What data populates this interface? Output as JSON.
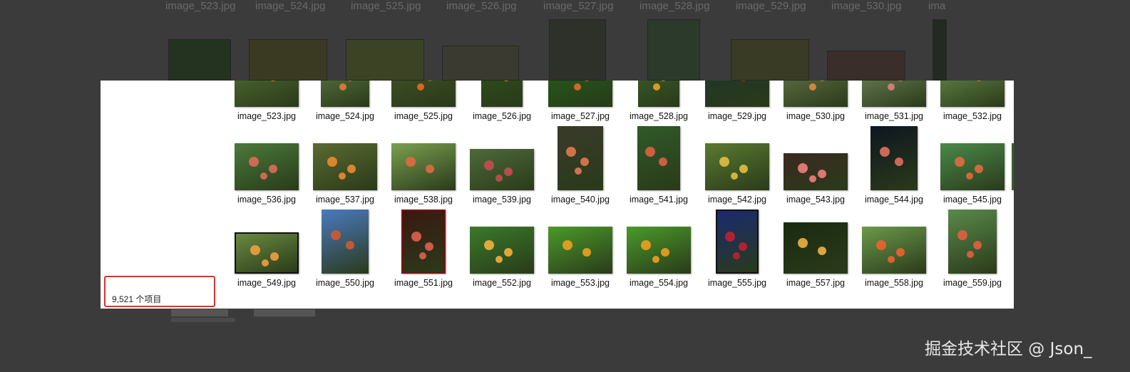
{
  "background_labels": [
    "image_523.jpg",
    "image_524.jpg",
    "image_525.jpg",
    "image_526.jpg",
    "image_527.jpg",
    "image_528.jpg",
    "image_529.jpg",
    "image_530.jpg",
    "ima"
  ],
  "status": {
    "item_count": "9,521 个项目"
  },
  "watermark": "掘金技术社区 @ Json_",
  "colors": {
    "highlight_box": "#e0302a",
    "background_dim": "#3b3b3b",
    "window_bg": "#ffffff"
  },
  "files": [
    {
      "name": "image_523.jpg"
    },
    {
      "name": "image_524.jpg"
    },
    {
      "name": "image_525.jpg"
    },
    {
      "name": "image_526.jpg"
    },
    {
      "name": "image_527.jpg"
    },
    {
      "name": "image_528.jpg"
    },
    {
      "name": "image_529.jpg"
    },
    {
      "name": "image_530.jpg"
    },
    {
      "name": "image_531.jpg"
    },
    {
      "name": "image_532.jpg"
    },
    {
      "name": "image_536.jpg"
    },
    {
      "name": "image_537.jpg"
    },
    {
      "name": "image_538.jpg"
    },
    {
      "name": "image_539.jpg"
    },
    {
      "name": "image_540.jpg"
    },
    {
      "name": "image_541.jpg"
    },
    {
      "name": "image_542.jpg"
    },
    {
      "name": "image_543.jpg"
    },
    {
      "name": "image_544.jpg"
    },
    {
      "name": "image_545.jpg"
    },
    {
      "name": "image_549.jpg"
    },
    {
      "name": "image_550.jpg"
    },
    {
      "name": "image_551.jpg"
    },
    {
      "name": "image_552.jpg"
    },
    {
      "name": "image_553.jpg"
    },
    {
      "name": "image_554.jpg"
    },
    {
      "name": "image_555.jpg"
    },
    {
      "name": "image_557.jpg"
    },
    {
      "name": "image_558.jpg"
    },
    {
      "name": "image_559.jpg"
    }
  ]
}
